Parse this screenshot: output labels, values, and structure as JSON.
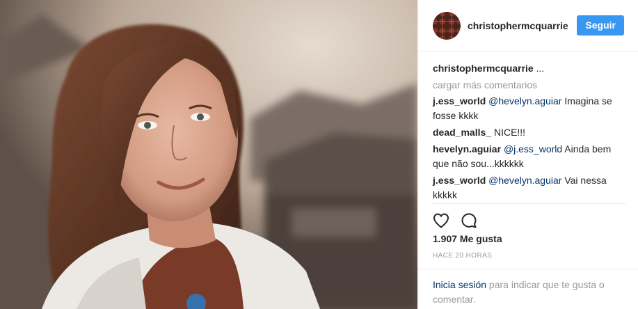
{
  "post": {
    "photo_alt_name": "post-photo",
    "header": {
      "username": "christophermcquarrie",
      "follow_label": "Seguir"
    },
    "caption": {
      "author": "christophermcquarrie",
      "ellipsis": " ..."
    },
    "load_more": "cargar más comentarios",
    "comments": [
      {
        "author": "j.ess_world",
        "mention": "@hevelyn.aguiar",
        "text": " Imagina se fosse kkkk"
      },
      {
        "author": "dead_malls_",
        "mention": "",
        "text": " NICE!!!"
      },
      {
        "author": "hevelyn.aguiar",
        "mention": "@j.ess_world",
        "text": " Ainda bem que não sou...kkkkkk"
      },
      {
        "author": "j.ess_world",
        "mention": "@hevelyn.aguiar",
        "text": " Vai nessa kkkkk"
      }
    ],
    "likes": "1.907 Me gusta",
    "time": "HACE 20 HORAS",
    "login": {
      "link": "Inicia sesión",
      "rest": " para indicar que te gusta o comentar."
    }
  },
  "icons": {
    "like": "heart-icon",
    "comment": "comment-icon"
  },
  "colors": {
    "accent": "#3897f0",
    "link": "#003569",
    "muted": "#999999"
  }
}
